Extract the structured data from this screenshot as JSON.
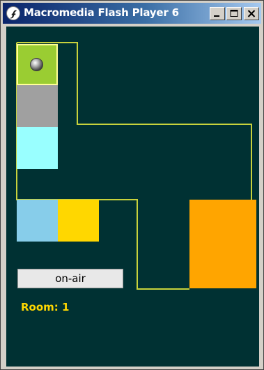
{
  "window": {
    "title": "Macromedia Flash Player 6",
    "icon": "flash-player-icon",
    "controls": {
      "minimize_icon": "minimize-icon",
      "maximize_icon": "maximize-icon",
      "close_icon": "close-icon"
    }
  },
  "stage": {
    "background": "#003133",
    "path_color": "#c8d23c",
    "tiles": [
      {
        "name": "green-tile",
        "color": "#9acd32"
      },
      {
        "name": "gray-tile",
        "color": "#a0a0a0"
      },
      {
        "name": "cyan-tile",
        "color": "#99ffff"
      },
      {
        "name": "light-blue-tile",
        "color": "#87cdea"
      },
      {
        "name": "yellow-tile",
        "color": "#ffd700"
      },
      {
        "name": "orange-tile",
        "color": "#ffa500"
      }
    ],
    "player_icon": "ball-icon"
  },
  "controls": {
    "onair_label": "on-air"
  },
  "status": {
    "room_label": "Room: 1"
  }
}
